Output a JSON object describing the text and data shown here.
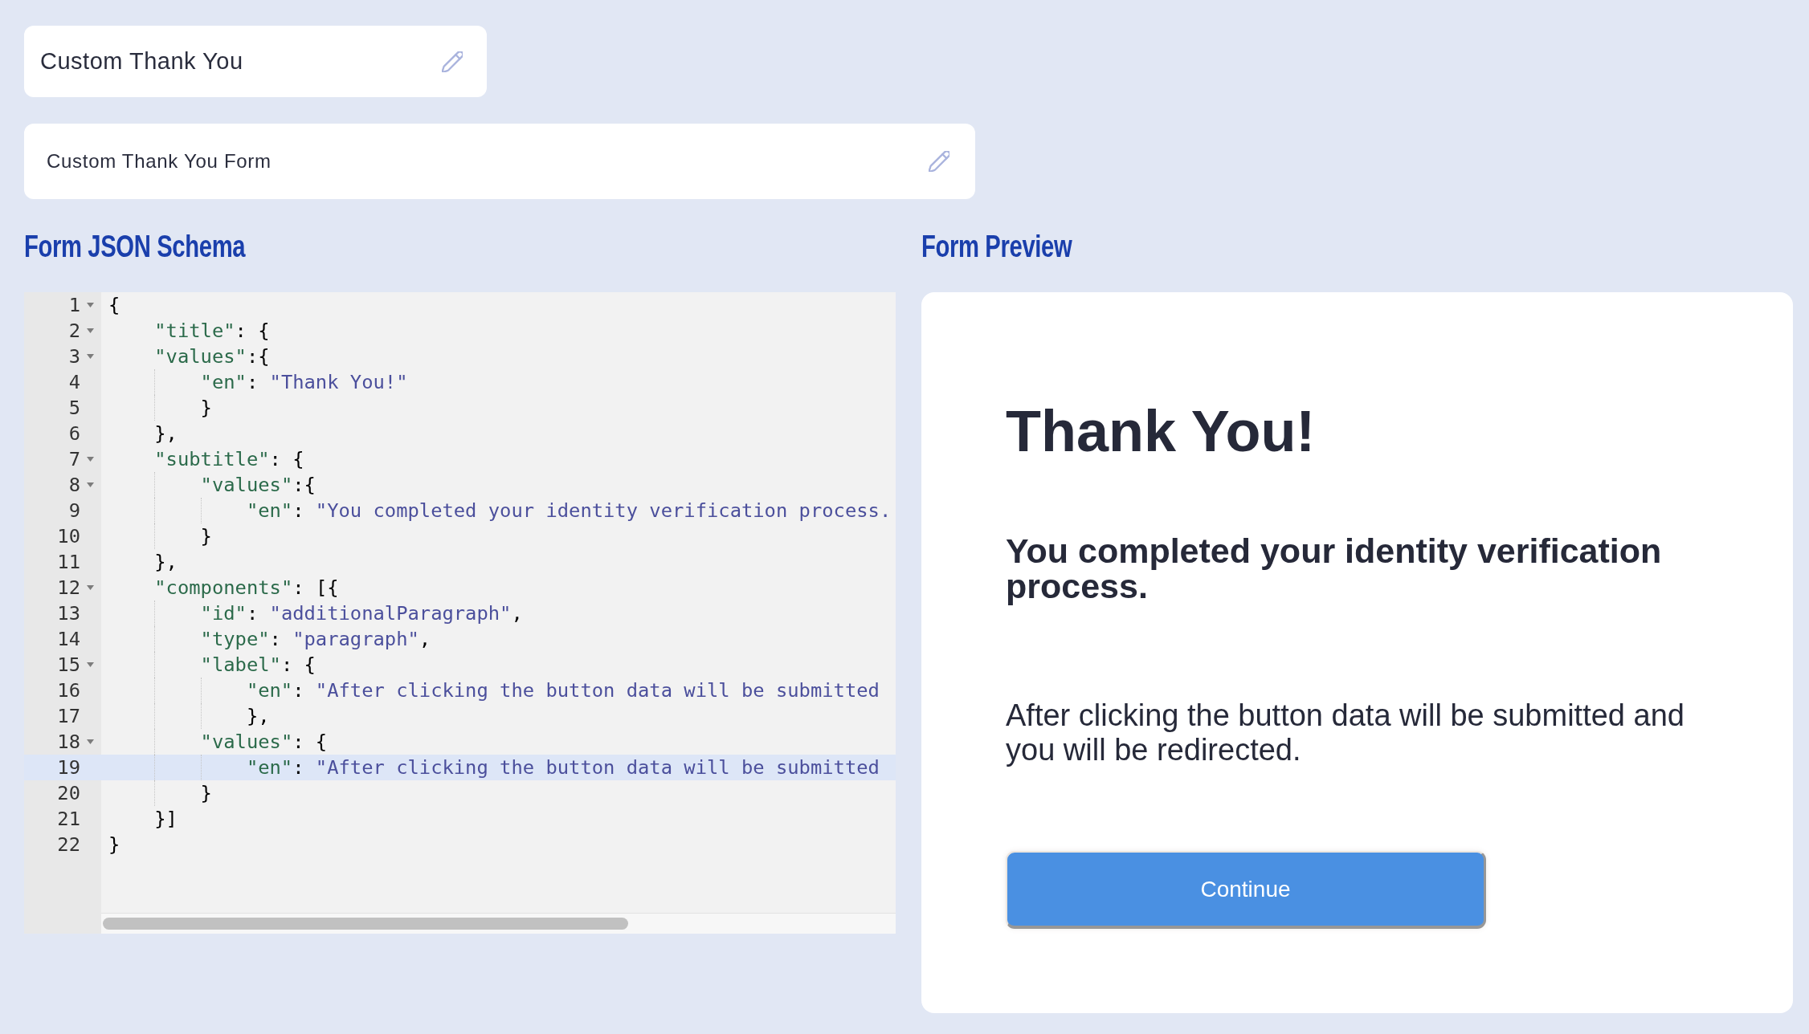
{
  "header": {
    "title": "Custom Thank You",
    "form_name": "Custom Thank You Form"
  },
  "schema_editor": {
    "heading": "Form JSON Schema",
    "lines": [
      {
        "number": "1",
        "text": "{",
        "foldable": true,
        "current": false
      },
      {
        "number": "2",
        "text": "    \"title\": {",
        "foldable": true,
        "current": false
      },
      {
        "number": "3",
        "text": "    \"values\":{",
        "foldable": true,
        "current": false
      },
      {
        "number": "4",
        "text": "        \"en\": \"Thank You!\"",
        "foldable": false,
        "current": false
      },
      {
        "number": "5",
        "text": "        }",
        "foldable": false,
        "current": false
      },
      {
        "number": "6",
        "text": "    },",
        "foldable": false,
        "current": false
      },
      {
        "number": "7",
        "text": "    \"subtitle\": {",
        "foldable": true,
        "current": false
      },
      {
        "number": "8",
        "text": "        \"values\":{",
        "foldable": true,
        "current": false
      },
      {
        "number": "9",
        "text": "            \"en\": \"You completed your identity verification process.",
        "foldable": false,
        "current": false
      },
      {
        "number": "10",
        "text": "        }",
        "foldable": false,
        "current": false
      },
      {
        "number": "11",
        "text": "    },",
        "foldable": false,
        "current": false
      },
      {
        "number": "12",
        "text": "    \"components\": [{",
        "foldable": true,
        "current": false
      },
      {
        "number": "13",
        "text": "        \"id\": \"additionalParagraph\",",
        "foldable": false,
        "current": false
      },
      {
        "number": "14",
        "text": "        \"type\": \"paragraph\",",
        "foldable": false,
        "current": false
      },
      {
        "number": "15",
        "text": "        \"label\": {",
        "foldable": true,
        "current": false
      },
      {
        "number": "16",
        "text": "            \"en\": \"After clicking the button data will be submitted",
        "foldable": false,
        "current": false
      },
      {
        "number": "17",
        "text": "            },",
        "foldable": false,
        "current": false
      },
      {
        "number": "18",
        "text": "        \"values\": {",
        "foldable": true,
        "current": false
      },
      {
        "number": "19",
        "text": "            \"en\": \"After clicking the button data will be submitted",
        "foldable": false,
        "current": true
      },
      {
        "number": "20",
        "text": "        }",
        "foldable": false,
        "current": false
      },
      {
        "number": "21",
        "text": "    }]",
        "foldable": false,
        "current": false
      },
      {
        "number": "22",
        "text": "}",
        "foldable": false,
        "current": false
      }
    ]
  },
  "preview": {
    "heading": "Form Preview",
    "title": "Thank You!",
    "subtitle": "You completed your identity verification process.",
    "paragraph": "After clicking the button data will be submitted and you will be redirected.",
    "button": "Continue"
  }
}
